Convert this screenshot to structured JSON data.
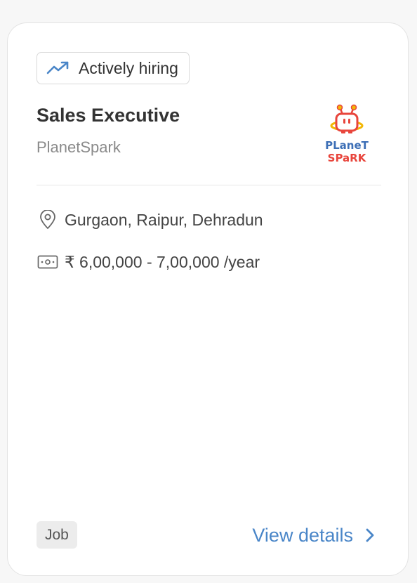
{
  "badge": {
    "label": "Actively hiring",
    "icon": "trending-up-icon"
  },
  "job": {
    "title": "Sales Executive",
    "company": "PlanetSpark"
  },
  "logo": {
    "icon": "planetspark-logo",
    "line1": "PLaneT",
    "line2": "SPaRK",
    "colors": {
      "robot": "#e8453c",
      "planet": "#f2b705",
      "line1": "#3d6fb6",
      "line2": "#e8453c"
    }
  },
  "details": {
    "location": "Gurgaon, Raipur, Dehradun",
    "location_icon": "location-pin-icon",
    "salary": "₹ 6,00,000 - 7,00,000 /year",
    "salary_icon": "money-icon"
  },
  "footer": {
    "tag": "Job",
    "view_details": "View details",
    "chevron_icon": "chevron-right-icon"
  },
  "colors": {
    "accent": "#4a86c8",
    "muted_text": "#8a8a8a",
    "card_bg": "#ffffff",
    "page_bg": "#f7f7f7"
  }
}
